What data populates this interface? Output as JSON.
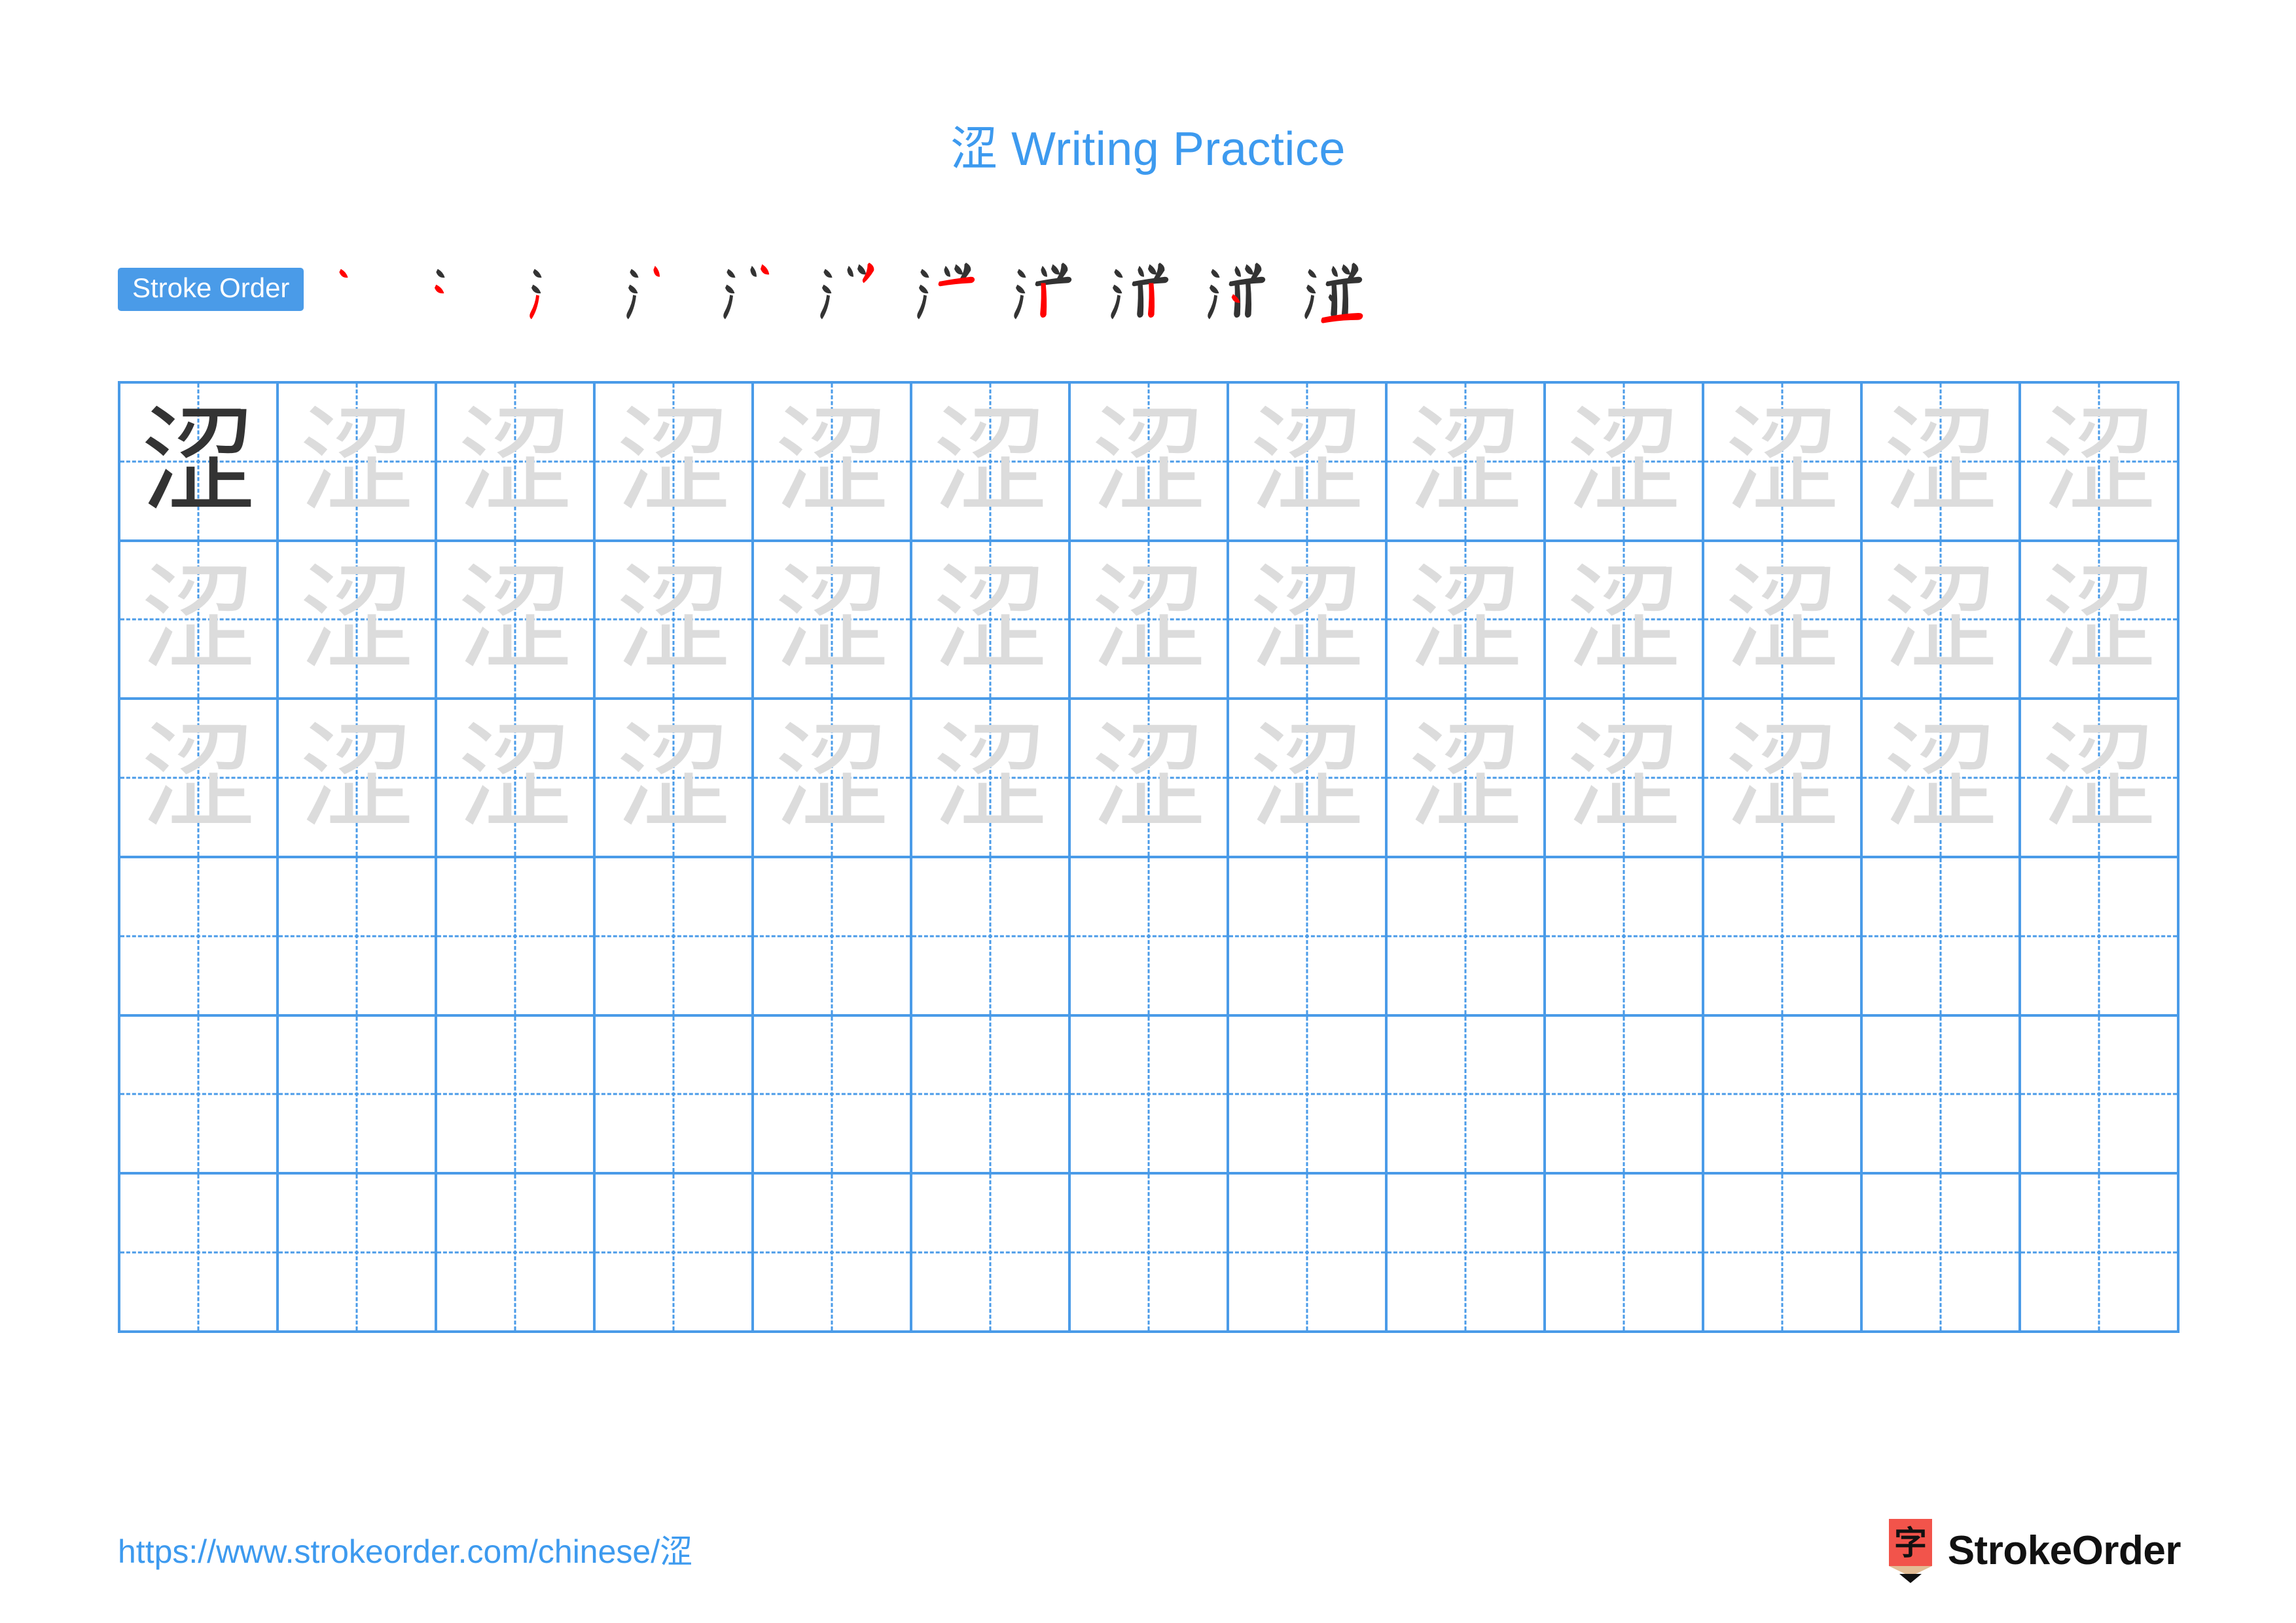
{
  "page": {
    "character": "涩",
    "title_suffix": " Writing Practice",
    "title_full": "涩 Writing Practice",
    "background": "#ffffff"
  },
  "colors": {
    "accent_blue": "#3d9aef",
    "grid_blue": "#4a9be8",
    "badge_blue": "#4a9be8",
    "stroke_new_red": "#ff0000",
    "stroke_done_black": "#333333",
    "trace_gray": "#dcdcdc",
    "logo_red": "#f2544b",
    "logo_wood": "#e3bd95"
  },
  "stroke_order": {
    "badge_label": "Stroke Order",
    "total_strokes": 11,
    "steps": [
      {
        "index": 1,
        "label": "stroke-1"
      },
      {
        "index": 2,
        "label": "stroke-2"
      },
      {
        "index": 3,
        "label": "stroke-3"
      },
      {
        "index": 4,
        "label": "stroke-4"
      },
      {
        "index": 5,
        "label": "stroke-5"
      },
      {
        "index": 6,
        "label": "stroke-6"
      },
      {
        "index": 7,
        "label": "stroke-7"
      },
      {
        "index": 8,
        "label": "stroke-8"
      },
      {
        "index": 9,
        "label": "stroke-9"
      },
      {
        "index": 10,
        "label": "stroke-10"
      },
      {
        "index": 11,
        "label": "stroke-11"
      }
    ]
  },
  "practice_grid": {
    "columns": 13,
    "rows": 6,
    "rows_data": [
      {
        "row": 1,
        "cells": [
          "dark",
          "trace",
          "trace",
          "trace",
          "trace",
          "trace",
          "trace",
          "trace",
          "trace",
          "trace",
          "trace",
          "trace",
          "trace"
        ]
      },
      {
        "row": 2,
        "cells": [
          "trace",
          "trace",
          "trace",
          "trace",
          "trace",
          "trace",
          "trace",
          "trace",
          "trace",
          "trace",
          "trace",
          "trace",
          "trace"
        ]
      },
      {
        "row": 3,
        "cells": [
          "trace",
          "trace",
          "trace",
          "trace",
          "trace",
          "trace",
          "trace",
          "trace",
          "trace",
          "trace",
          "trace",
          "trace",
          "trace"
        ]
      },
      {
        "row": 4,
        "cells": [
          "empty",
          "empty",
          "empty",
          "empty",
          "empty",
          "empty",
          "empty",
          "empty",
          "empty",
          "empty",
          "empty",
          "empty",
          "empty"
        ]
      },
      {
        "row": 5,
        "cells": [
          "empty",
          "empty",
          "empty",
          "empty",
          "empty",
          "empty",
          "empty",
          "empty",
          "empty",
          "empty",
          "empty",
          "empty",
          "empty"
        ]
      },
      {
        "row": 6,
        "cells": [
          "empty",
          "empty",
          "empty",
          "empty",
          "empty",
          "empty",
          "empty",
          "empty",
          "empty",
          "empty",
          "empty",
          "empty",
          "empty"
        ]
      }
    ]
  },
  "footer": {
    "url": "https://www.strokeorder.com/chinese/涩",
    "brand_name": "StrokeOrder",
    "brand_mark_character": "字"
  }
}
